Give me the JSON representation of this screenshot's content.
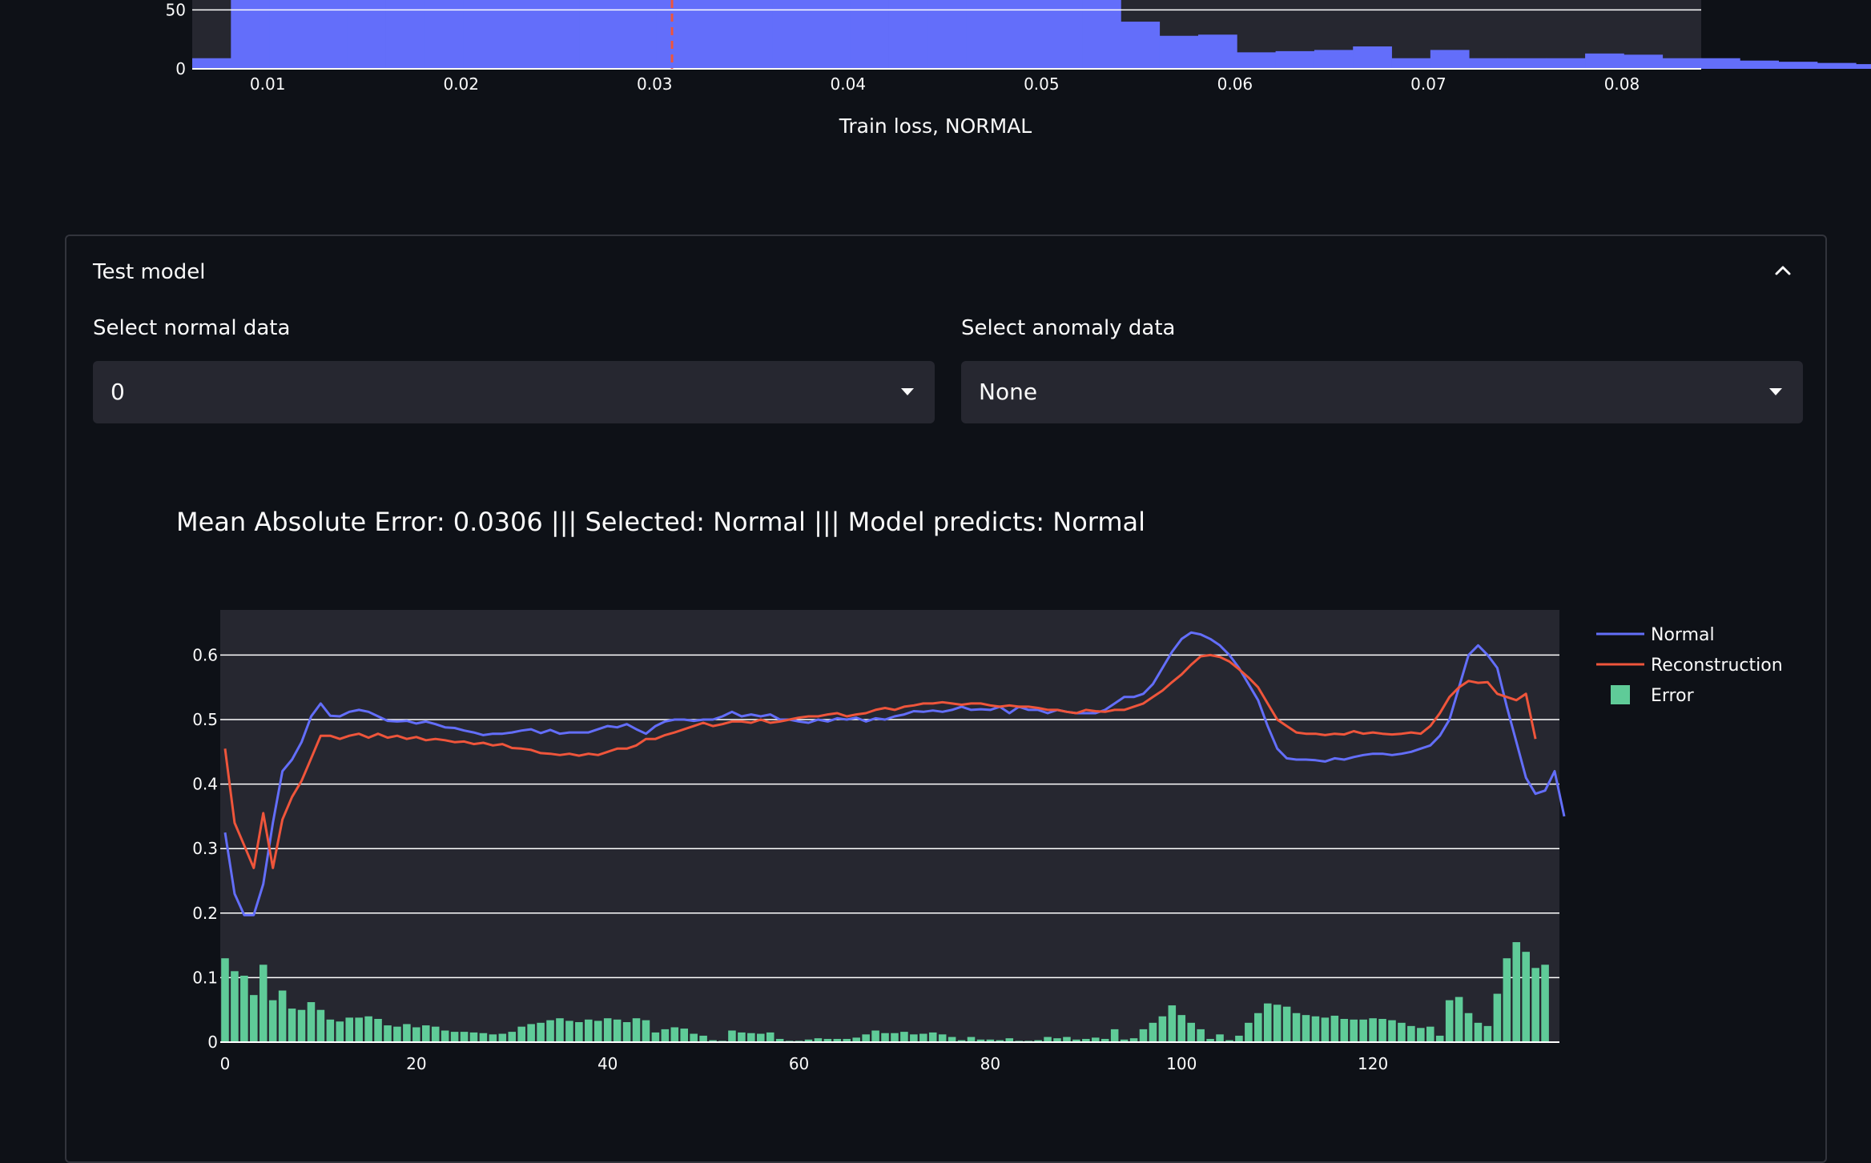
{
  "histogram": {
    "xlabel": "Train loss, NORMAL",
    "x_ticks": [
      "0.01",
      "0.02",
      "0.03",
      "0.04",
      "0.05",
      "0.06",
      "0.07",
      "0.08"
    ],
    "y_ticks": [
      "0",
      "50"
    ]
  },
  "expander": {
    "title": "Test model",
    "chevron_icon": "chevron-up-icon"
  },
  "normal_select": {
    "label": "Select normal data",
    "value": "0"
  },
  "anomaly_select": {
    "label": "Select anomaly data",
    "value": "None"
  },
  "result_text": "Mean Absolute Error: 0.0306 ||| Selected: Normal ||| Model predicts: Normal",
  "colors": {
    "background": "#0e1117",
    "plot_bg": "#262730",
    "normal": "#636efa",
    "reconstruction": "#ef553b",
    "error": "#5fcb98",
    "threshold": "#ef553b"
  },
  "chart_data": [
    {
      "type": "bar",
      "xlabel": "Train loss, NORMAL",
      "ylabel": "",
      "xlim": [
        0.0061,
        0.0841
      ],
      "ylim": [
        0,
        95
      ],
      "x_ticks": [
        0.01,
        0.02,
        0.03,
        0.04,
        0.05,
        0.06,
        0.07,
        0.08
      ],
      "y_ticks": [
        0,
        50
      ],
      "threshold": 0.0309,
      "bins_start": 0.0061,
      "bin_width": 0.002,
      "counts": [
        9,
        95,
        95,
        95,
        95,
        95,
        95,
        95,
        95,
        95,
        95,
        95,
        95,
        95,
        95,
        95,
        95,
        95,
        95,
        95,
        95,
        95,
        95,
        95,
        40,
        28,
        29,
        14,
        15,
        16,
        19,
        9,
        16,
        9,
        9,
        9,
        13,
        12,
        9,
        9,
        7,
        6,
        5,
        4,
        4,
        4,
        3,
        2,
        2,
        2,
        1,
        1,
        1,
        1,
        1,
        1,
        1,
        1,
        1,
        1,
        2,
        2,
        1,
        1,
        2,
        1,
        2,
        1,
        1
      ]
    },
    {
      "type": "line",
      "xlim": [
        -0.5,
        139.5
      ],
      "ylim": [
        0,
        0.67
      ],
      "x_ticks": [
        0,
        20,
        40,
        60,
        80,
        100,
        120
      ],
      "y_ticks": [
        0,
        0.1,
        0.2,
        0.3,
        0.4,
        0.5,
        0.6
      ],
      "legend_position": "top-right",
      "series": [
        {
          "name": "Normal",
          "type": "line",
          "values": [
            0.325,
            0.23,
            0.197,
            0.197,
            0.245,
            0.34,
            0.42,
            0.438,
            0.465,
            0.505,
            0.525,
            0.506,
            0.505,
            0.512,
            0.515,
            0.512,
            0.505,
            0.498,
            0.497,
            0.498,
            0.494,
            0.497,
            0.493,
            0.488,
            0.487,
            0.483,
            0.48,
            0.476,
            0.478,
            0.478,
            0.48,
            0.483,
            0.485,
            0.479,
            0.484,
            0.478,
            0.48,
            0.48,
            0.48,
            0.485,
            0.49,
            0.488,
            0.493,
            0.485,
            0.478,
            0.49,
            0.497,
            0.5,
            0.5,
            0.498,
            0.5,
            0.5,
            0.505,
            0.512,
            0.505,
            0.508,
            0.505,
            0.508,
            0.5,
            0.5,
            0.497,
            0.495,
            0.5,
            0.497,
            0.502,
            0.5,
            0.503,
            0.497,
            0.502,
            0.5,
            0.505,
            0.508,
            0.513,
            0.512,
            0.514,
            0.512,
            0.515,
            0.52,
            0.515,
            0.516,
            0.515,
            0.52,
            0.51,
            0.52,
            0.515,
            0.515,
            0.51,
            0.515,
            0.512,
            0.51,
            0.51,
            0.51,
            0.515,
            0.525,
            0.535,
            0.535,
            0.54,
            0.555,
            0.58,
            0.605,
            0.625,
            0.635,
            0.632,
            0.625,
            0.615,
            0.6,
            0.58,
            0.555,
            0.53,
            0.49,
            0.455,
            0.44,
            0.438,
            0.438,
            0.437,
            0.435,
            0.44,
            0.438,
            0.442,
            0.445,
            0.447,
            0.447,
            0.445,
            0.447,
            0.45,
            0.455,
            0.46,
            0.475,
            0.5,
            0.55,
            0.6,
            0.615,
            0.6,
            0.58,
            0.52,
            0.465,
            0.41,
            0.385,
            0.39,
            0.42,
            0.35
          ],
          "color": "#636efa"
        },
        {
          "name": "Reconstruction",
          "type": "line",
          "values": [
            0.455,
            0.34,
            0.305,
            0.27,
            0.355,
            0.27,
            0.345,
            0.38,
            0.405,
            0.44,
            0.475,
            0.475,
            0.47,
            0.475,
            0.478,
            0.472,
            0.478,
            0.472,
            0.475,
            0.47,
            0.473,
            0.468,
            0.47,
            0.468,
            0.465,
            0.466,
            0.462,
            0.464,
            0.46,
            0.462,
            0.456,
            0.455,
            0.453,
            0.448,
            0.447,
            0.445,
            0.447,
            0.444,
            0.447,
            0.445,
            0.45,
            0.455,
            0.455,
            0.46,
            0.47,
            0.47,
            0.476,
            0.48,
            0.485,
            0.49,
            0.495,
            0.49,
            0.493,
            0.497,
            0.497,
            0.495,
            0.5,
            0.495,
            0.497,
            0.5,
            0.503,
            0.505,
            0.505,
            0.508,
            0.51,
            0.505,
            0.508,
            0.51,
            0.515,
            0.518,
            0.515,
            0.52,
            0.522,
            0.525,
            0.525,
            0.527,
            0.525,
            0.523,
            0.525,
            0.525,
            0.522,
            0.52,
            0.522,
            0.52,
            0.52,
            0.518,
            0.515,
            0.515,
            0.512,
            0.51,
            0.515,
            0.513,
            0.512,
            0.515,
            0.515,
            0.52,
            0.525,
            0.535,
            0.545,
            0.558,
            0.57,
            0.585,
            0.598,
            0.6,
            0.597,
            0.59,
            0.578,
            0.565,
            0.55,
            0.525,
            0.5,
            0.49,
            0.48,
            0.478,
            0.478,
            0.476,
            0.478,
            0.477,
            0.482,
            0.478,
            0.48,
            0.478,
            0.477,
            0.478,
            0.48,
            0.478,
            0.49,
            0.51,
            0.535,
            0.55,
            0.56,
            0.557,
            0.558,
            0.54,
            0.535,
            0.53,
            0.54,
            0.47
          ],
          "color": "#ef553b"
        },
        {
          "name": "Error",
          "type": "bar",
          "values": [
            0.13,
            0.11,
            0.103,
            0.073,
            0.12,
            0.065,
            0.08,
            0.052,
            0.05,
            0.062,
            0.05,
            0.035,
            0.032,
            0.038,
            0.038,
            0.04,
            0.036,
            0.026,
            0.024,
            0.028,
            0.023,
            0.026,
            0.024,
            0.018,
            0.016,
            0.016,
            0.015,
            0.014,
            0.012,
            0.013,
            0.016,
            0.024,
            0.028,
            0.03,
            0.034,
            0.037,
            0.033,
            0.031,
            0.035,
            0.033,
            0.037,
            0.035,
            0.031,
            0.037,
            0.034,
            0.015,
            0.02,
            0.023,
            0.021,
            0.013,
            0.01,
            0.003,
            0.002,
            0.018,
            0.015,
            0.014,
            0.013,
            0.015,
            0.005,
            0.002,
            0.002,
            0.004,
            0.006,
            0.005,
            0.005,
            0.005,
            0.007,
            0.012,
            0.018,
            0.014,
            0.014,
            0.016,
            0.012,
            0.013,
            0.015,
            0.012,
            0.008,
            0.003,
            0.008,
            0.004,
            0.004,
            0.003,
            0.006,
            0.002,
            0.002,
            0.003,
            0.008,
            0.006,
            0.008,
            0.004,
            0.005,
            0.007,
            0.005,
            0.02,
            0.004,
            0.006,
            0.02,
            0.03,
            0.04,
            0.057,
            0.042,
            0.03,
            0.02,
            0.005,
            0.012,
            0.003,
            0.01,
            0.03,
            0.045,
            0.06,
            0.058,
            0.055,
            0.045,
            0.042,
            0.04,
            0.038,
            0.041,
            0.036,
            0.035,
            0.035,
            0.037,
            0.036,
            0.034,
            0.03,
            0.025,
            0.022,
            0.024,
            0.01,
            0.065,
            0.07,
            0.045,
            0.03,
            0.025,
            0.075,
            0.13,
            0.155,
            0.14,
            0.115,
            0.12
          ],
          "color": "#5fcb98"
        }
      ]
    }
  ]
}
